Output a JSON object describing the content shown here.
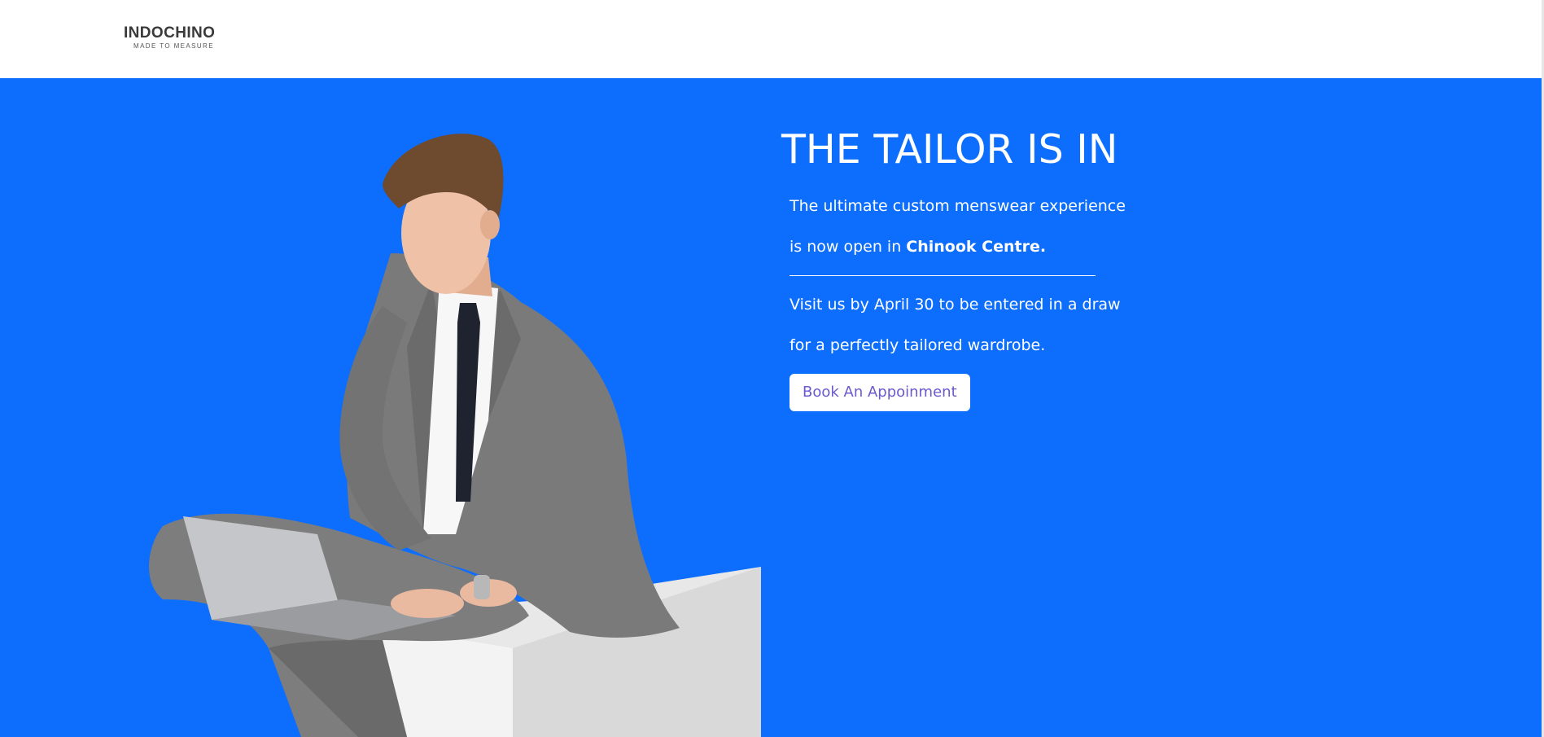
{
  "header": {
    "logo_word": "INDOCHINO",
    "logo_tagline": "MADE TO MEASURE"
  },
  "hero": {
    "headline": "THE TAILOR IS IN",
    "intro_line_1": "The ultimate custom menswear experience",
    "intro_line_2_prefix": "is now open in ",
    "intro_line_2_location": "Chinook Centre.",
    "promo_line_1": "Visit us by April 30 to be entered in a draw",
    "promo_line_2": "for a perfectly tailored wardrobe.",
    "cta_label": "Book An Appoinment",
    "image": "man-in-grey-suit-with-laptop-on-white-cube"
  },
  "colors": {
    "hero_background": "#0d6efd",
    "button_background": "#ffffff",
    "button_text": "#6a5acd",
    "logo_text": "#3a3a3a"
  }
}
